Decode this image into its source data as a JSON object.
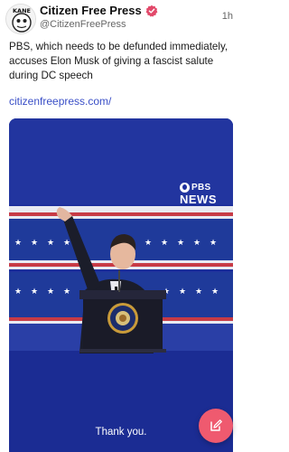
{
  "post": {
    "author_name": "Citizen Free Press",
    "author_handle": "@CitizenFreePress",
    "timestamp": "1h",
    "verified": true,
    "text": "PBS, which needs to be defunded immediately, accuses Elon Musk of giving a fascist salute during DC speech",
    "link_text": "citizenfreepress.com/"
  },
  "avatar": {
    "logo_text": "KANE"
  },
  "media": {
    "logo_pbs": "PBS",
    "logo_news": "NEWS",
    "caption": "Thank you."
  },
  "icons": {
    "verified": "verified-badge-icon",
    "compose": "compose-icon"
  },
  "colors": {
    "link": "#3a4fc7",
    "verified": "#e2496a",
    "fab": "#ef5a6f",
    "media_bg": "#1d2f9c"
  }
}
